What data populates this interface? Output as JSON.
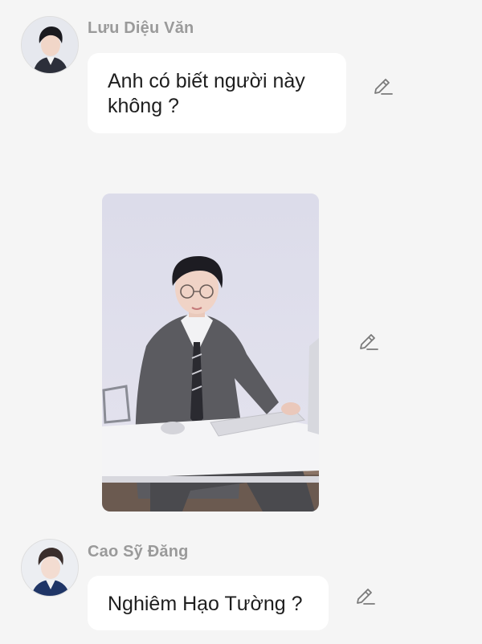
{
  "messages": [
    {
      "sender": "Lưu Diệu Văn",
      "text": "Anh có biết người này không ?"
    },
    {
      "sender": "Cao Sỹ Đăng",
      "text": "Nghiêm Hạo Tường ?"
    }
  ],
  "icons": {
    "edit": "pencil-edit-icon",
    "avatar": "user-avatar-photo"
  },
  "colors": {
    "background": "#f5f5f5",
    "bubble": "#ffffff",
    "sender_name": "#9a9a9a",
    "message_text": "#1e1e1e",
    "icon": "#7a7a7a"
  }
}
